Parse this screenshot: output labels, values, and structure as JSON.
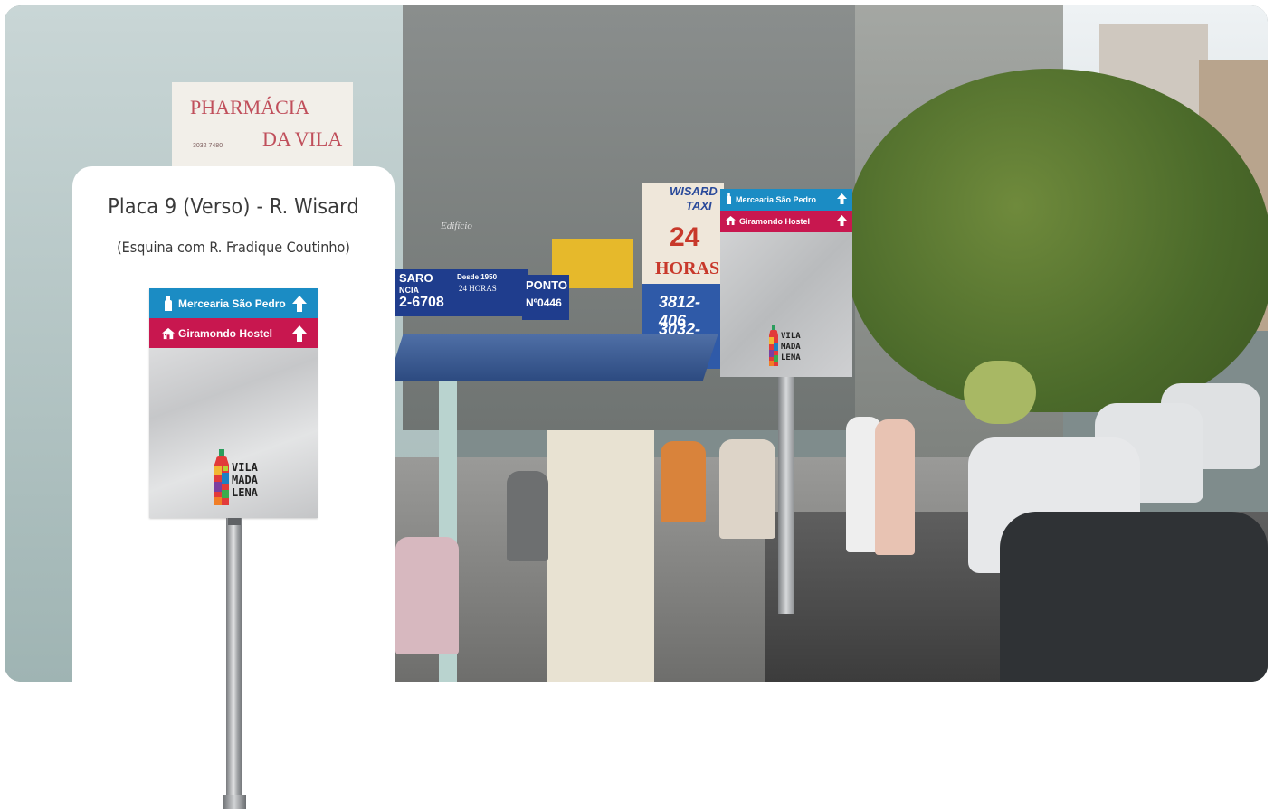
{
  "card": {
    "title": "Placa 9 (Verso) - R. Wisard",
    "subtitle": "(Esquina com R. Fradique Coutinho)"
  },
  "sign": {
    "rows": [
      {
        "label": "Mercearia São Pedro",
        "icon": "bottle-icon",
        "color": "#1b8cc4",
        "direction": "up-arrow-icon"
      },
      {
        "label": "Giramondo Hostel",
        "icon": "house-icon",
        "color": "#c8174f",
        "direction": "up-arrow-icon"
      }
    ],
    "logo": [
      "VILA",
      "MADA",
      "LENA"
    ]
  },
  "photo": {
    "storefront_1": "PHARMÁCIA",
    "storefront_2": "DA VILA",
    "phone_small": "3032 7480",
    "sign_blue_1": "SARO",
    "sign_blue_2": "Desde 1950",
    "sign_blue_3": "NCIA",
    "sign_blue_4": "24 HORAS",
    "sign_blue_5": "2-6708",
    "ponto_1": "PONTO",
    "ponto_2": "Nº0446",
    "taxi_1": "WISARD",
    "taxi_2": "TAXI",
    "taxi_3": "24",
    "taxi_4": "HORAS",
    "taxi_5": "3812-406",
    "taxi_6": "3032-670",
    "edificio": "Edifício",
    "sign_rows": [
      {
        "label": "Mercearia São Pedro",
        "color": "#1b8cc4"
      },
      {
        "label": "Giramondo Hostel",
        "color": "#c8174f"
      }
    ],
    "logo": [
      "VILA",
      "MADA",
      "LENA"
    ]
  }
}
